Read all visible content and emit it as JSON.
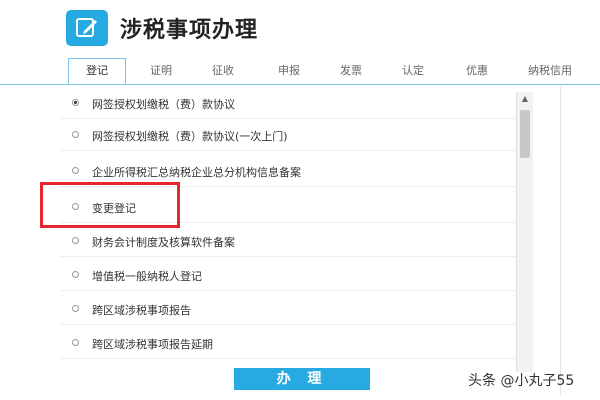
{
  "header": {
    "title": "涉税事项办理",
    "icon": "edit-icon"
  },
  "tabs": [
    {
      "label": "登记",
      "active": true
    },
    {
      "label": "证明",
      "active": false
    },
    {
      "label": "征收",
      "active": false
    },
    {
      "label": "申报",
      "active": false
    },
    {
      "label": "发票",
      "active": false
    },
    {
      "label": "认定",
      "active": false
    },
    {
      "label": "优惠",
      "active": false
    },
    {
      "label": "纳税信用",
      "active": false
    }
  ],
  "items": [
    {
      "label": "网签授权划缴税（费）款协议",
      "checked": true
    },
    {
      "label": "网签授权划缴税（费）款协议(一次上门)",
      "checked": false
    },
    {
      "label": "企业所得税汇总纳税企业总分机构信息备案",
      "checked": false
    },
    {
      "label": "变更登记",
      "checked": false,
      "highlighted": true
    },
    {
      "label": "财务会计制度及核算软件备案",
      "checked": false
    },
    {
      "label": "增值税一般纳税人登记",
      "checked": false
    },
    {
      "label": "跨区域涉税事项报告",
      "checked": false
    },
    {
      "label": "跨区域涉税事项报告延期",
      "checked": false
    }
  ],
  "submit_label": "办 理",
  "watermark": "头条 @小丸子55",
  "colors": {
    "accent": "#27a9e1",
    "highlight": "#e8262d"
  }
}
